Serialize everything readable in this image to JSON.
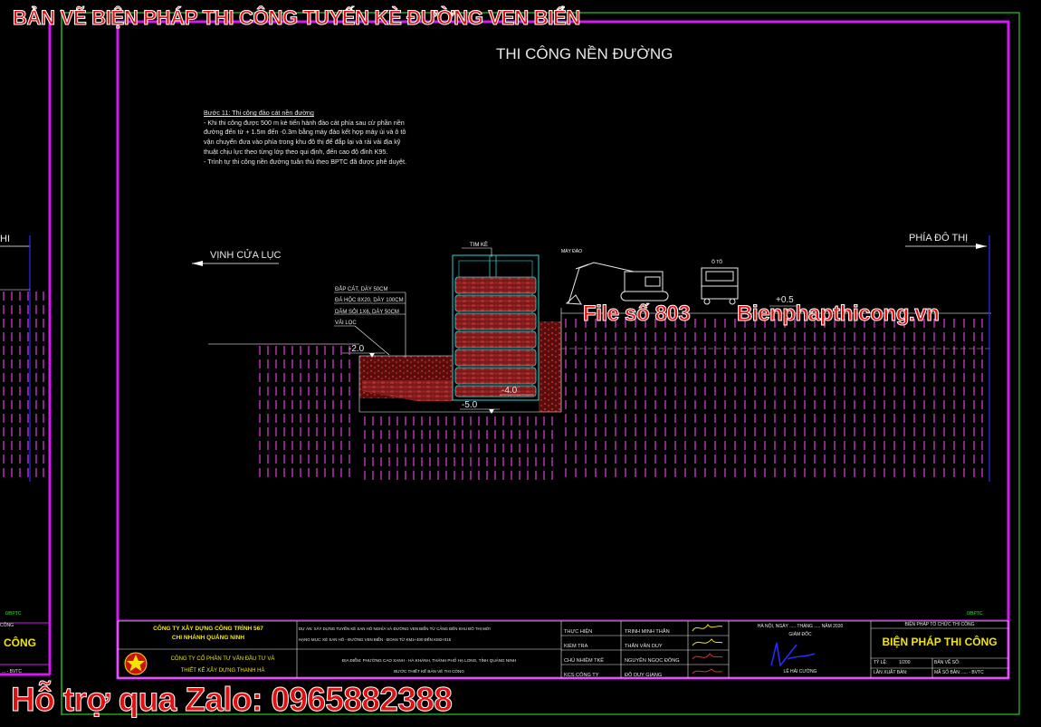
{
  "banner_title": "BẢN VẼ BIỆN PHÁP THI CÔNG TUYẾN KÈ ĐƯỜNG VEN BIỂN",
  "sheet_title": "THI CÔNG NỀN ĐƯỜNG",
  "notes": {
    "heading": "Bước 11: Thi công đào cát nền đường",
    "lines": [
      "- Khi thi công được 500 m kè tiến hành đào cát phía sau cừ phần nền",
      "đường đến từ + 1.5m đến -0.3m bằng máy đào kết hợp máy ủi và ô tô",
      "vận chuyển đưa vào phía trong khu đô thị để đắp lại và rải vải địa kỹ",
      "thuật chịu lực theo từng lớp theo qui định, đến cao độ đỉnh K95.",
      "- Trình tự thi công nền đường tuân thủ theo BPTC đã được phê duyệt."
    ]
  },
  "labels": {
    "left_side": "VỊNH CỬA LỤC",
    "right_side": "PHÍA ĐÔ THỊ",
    "left_edge": "HI",
    "tim_ke": "TIM KÈ",
    "may_dao": "MÁY ĐÀO",
    "o_to": "Ô TÔ",
    "layers": [
      "ĐẮP CÁT, DÀY 50CM",
      "ĐÁ HỘC 8X20, DÀY 100CM",
      "DĂM SỎI 1X6, DÀY 50CM",
      "VẢI LỌC"
    ],
    "elevations": {
      "e_plus": "+0.5",
      "e_m2": "-2.0",
      "e_m4": "-4.0",
      "e_m5": "-5.0"
    }
  },
  "watermark": {
    "file": "File số 803",
    "site": "Bienphapthicong.vn",
    "zalo": "Hỗ trợ qua Zalo: 0965882388"
  },
  "left_sheet": {
    "code_top": "0/BPTC",
    "code_small": "CÔNG",
    "title_part": "CÔNG",
    "code_bottom": "... - BVTC"
  },
  "title_block": {
    "company1": "CÔNG TY XÂY DỰNG CÔNG TRÌNH 567",
    "company2": "CHI NHÁNH QUẢNG NINH",
    "consultant1": "CÔNG TY CỔ PHẦN TƯ VẤN ĐẦU TƯ VÀ",
    "consultant2": "THIẾT KẾ XÂY DỰNG THANH HÀ",
    "project1": "DỰ ÁN: XÂY DỰNG TUYẾN KÈ SAN HÔ NGHĨA VÀ ĐƯỜNG VEN BIỂN TỪ CẢNG ĐẾN KHU ĐÔ THỊ MỚI",
    "project2": "HẠNG MỤC: KÈ SAN HÔ - ĐƯỜNG VEN BIỂN - ĐOẠN TỪ KM1+400 ĐẾN KM2+015",
    "location": "ĐỊA ĐIỂM: PHƯỜNG CAO XANH - HÀ KHÁNH, THÀNH PHỐ HẠ LONG, TỈNH QUẢNG NINH",
    "stage": "BƯỚC THIẾT KẾ BẢN VẼ THI CÔNG",
    "roles": [
      "THỰC HIỆN",
      "KIỂM TRA",
      "CHỦ NHIỆM TKẾ",
      "KCS CÔNG TY"
    ],
    "names": [
      "TRỊNH MINH THẮN",
      "THÂN VĂN DUY",
      "NGUYỄN NGỌC ĐÔNG",
      "ĐỖ DUY GIANG"
    ],
    "date_line": "HÀ NỘI, NGÀY ..... THÁNG ..... NĂM 2020",
    "director_title": "GIÁM ĐỐC",
    "director_name": "LÊ HẢI CƯỜNG",
    "code_top": "0/BPTC",
    "doc_header": "BIỆN PHÁP TỔ CHỨC THI CÔNG",
    "drawing_title": "BIỆN PHÁP THI CÔNG",
    "scale_label": "TỶ LỆ:",
    "scale_value": "1/200",
    "sheet_no_label": "BẢN VẼ SỐ:",
    "issue_label": "LẦN XUẤT BẢN:",
    "code_label": "MÃ SỐ BẢN:",
    "code_value": "..... - BVTC"
  },
  "colors": {
    "frame_magenta": "#d318f2",
    "frame_green": "#27c927",
    "pile_magenta": "#e040e0",
    "banner_red": "#e01010",
    "soil_red": "#8a1818",
    "title_yellow": "#f2e600"
  }
}
